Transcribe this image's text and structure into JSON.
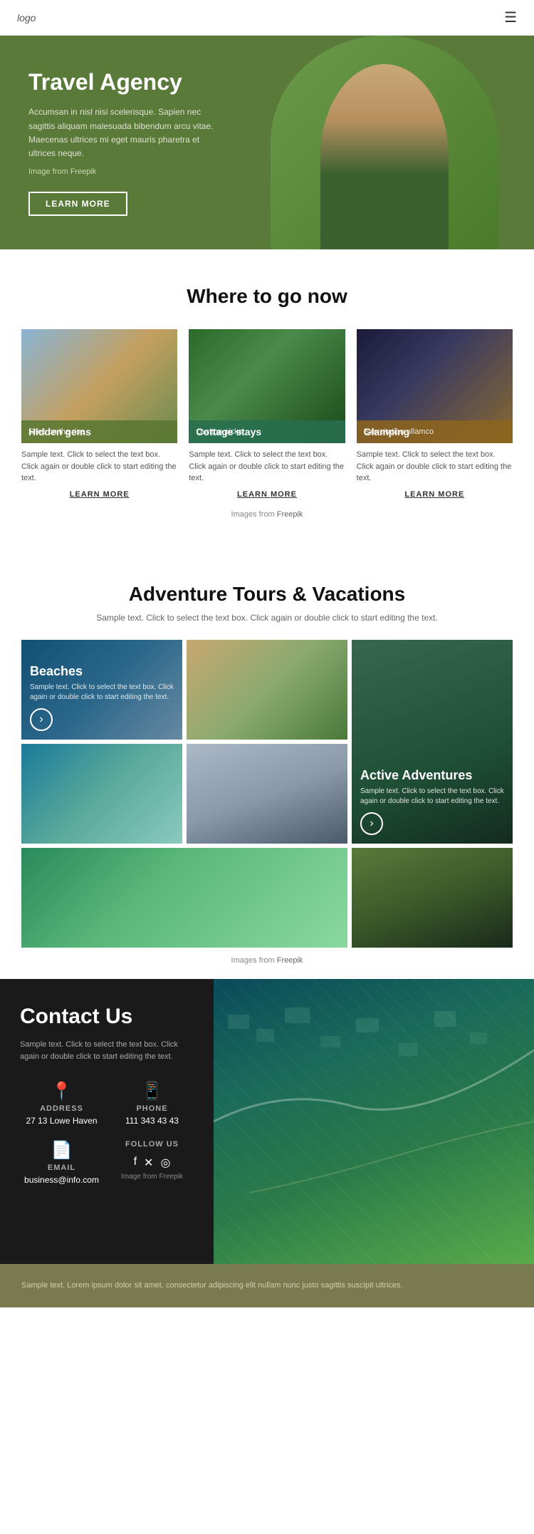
{
  "header": {
    "logo": "logo",
    "menu_icon": "☰"
  },
  "hero": {
    "title": "Travel Agency",
    "description": "Accumsan in nisl nisi scelerisque. Sapien nec sagittis aliquam malesuada bibendum arcu vitae. Maecenas ultrices mi eget mauris pharetra et ultrices neque.",
    "image_credit_prefix": "Image from",
    "image_credit_link": "Freepik",
    "learn_more": "LEARN MORE"
  },
  "where_section": {
    "title": "Where to go now",
    "cards": [
      {
        "id": "hidden-gems",
        "label": "Hidden gems",
        "sub": "Sites on the rise",
        "text": "Sample text. Click to select the text box. Click again or double click to start editing the text.",
        "learn_more": "LEARN MORE",
        "bg_class": "img-tent",
        "overlay_class": "bg-green"
      },
      {
        "id": "cottage-stays",
        "label": "Cottage stays",
        "sub": "Our top picks",
        "text": "Sample text. Click to select the text box. Click again or double click to start editing the text.",
        "learn_more": "LEARN MORE",
        "bg_class": "img-cabin",
        "overlay_class": "bg-teal"
      },
      {
        "id": "glamping",
        "label": "Glamping",
        "sub": "Exercitation ullamco",
        "text": "Sample text. Click to select the text box. Click again or double click to start editing the text.",
        "learn_more": "LEARN MORE",
        "bg_class": "img-glamp",
        "overlay_class": "bg-amber"
      }
    ],
    "freepik_prefix": "Images from",
    "freepik_link": "Freepik"
  },
  "adventure_section": {
    "title": "Adventure Tours & Vacations",
    "subtitle": "Sample text. Click to select the text box. Click again or double click to start editing the text.",
    "cells": [
      {
        "id": "beaches",
        "title": "Beaches",
        "desc": "Sample text. Click to select the text box. Click again or double click to start editing the text.",
        "has_btn": true,
        "bg": "adv-img-beach",
        "span_col": 1,
        "span_row": 1
      },
      {
        "id": "forest-1",
        "title": "",
        "desc": "",
        "has_btn": false,
        "bg": "adv-img-forest",
        "span_col": 1,
        "span_row": 1
      },
      {
        "id": "active-adventures",
        "title": "Active Adventures",
        "desc": "Sample text. Click to select the text box. Click again or double click to start editing the text.",
        "has_btn": true,
        "bg": "adv-img-tropical",
        "span_col": 1,
        "span_row": 2
      },
      {
        "id": "coast",
        "title": "",
        "desc": "",
        "has_btn": false,
        "bg": "adv-img-coast",
        "span_col": 1,
        "span_row": 1
      },
      {
        "id": "mountain",
        "title": "",
        "desc": "",
        "has_btn": false,
        "bg": "adv-img-mountain",
        "span_col": 1,
        "span_row": 1
      },
      {
        "id": "palm",
        "title": "",
        "desc": "",
        "has_btn": false,
        "bg": "adv-img-palm",
        "span_col": 1,
        "span_row": 1
      },
      {
        "id": "road",
        "title": "",
        "desc": "",
        "has_btn": false,
        "bg": "adv-img-road",
        "span_col": 1,
        "span_row": 1
      }
    ],
    "freepik_prefix": "Images from",
    "freepik_link": "Freepik"
  },
  "contact_section": {
    "title": "Contact Us",
    "description": "Sample text. Click to select the text box. Click again or double click to start editing the text.",
    "address_label": "ADDRESS",
    "address_value": "27 13 Lowe Haven",
    "phone_label": "PHONE",
    "phone_value": "111 343 43 43",
    "email_label": "EMAIL",
    "email_value": "business@info.com",
    "follow_label": "FOLLOW US",
    "social_icons": [
      "f",
      "✕",
      "◎"
    ],
    "image_credit": "Image from",
    "image_credit_link": "Freepik"
  },
  "footer": {
    "text": "Sample text. Lorem ipsum dolor sit amet, consectetur adipiscing elit nullam nunc justo sagittis suscipit ultrices."
  }
}
